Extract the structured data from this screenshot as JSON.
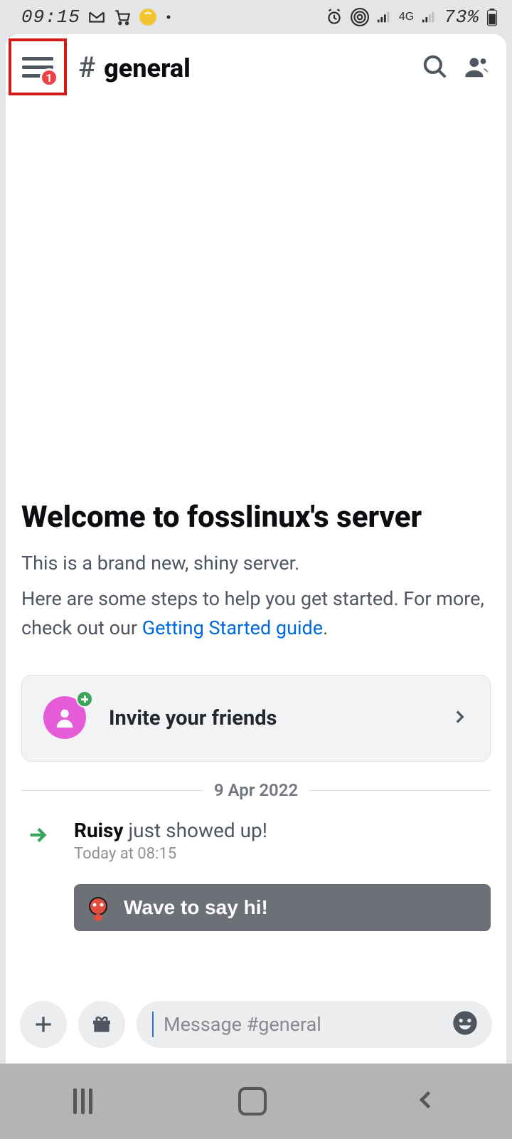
{
  "status": {
    "time": "09:15",
    "battery": "73%",
    "network": "4G"
  },
  "header": {
    "menu_badge": "1",
    "channel_name": "general"
  },
  "welcome": {
    "title": "Welcome to fosslinux's server",
    "line1": "This is a brand new, shiny server.",
    "line2a": "Here are some steps to help you get started. For more, check out our ",
    "link": "Getting Started guide",
    "link_suffix": "."
  },
  "invite_card": {
    "label": "Invite your friends"
  },
  "divider": {
    "date": "9 Apr 2022"
  },
  "system_message": {
    "user": "Ruisy",
    "suffix": " just showed up!",
    "timestamp": "Today at 08:15",
    "wave_label": "Wave to say hi!"
  },
  "composer": {
    "placeholder": "Message #general"
  }
}
